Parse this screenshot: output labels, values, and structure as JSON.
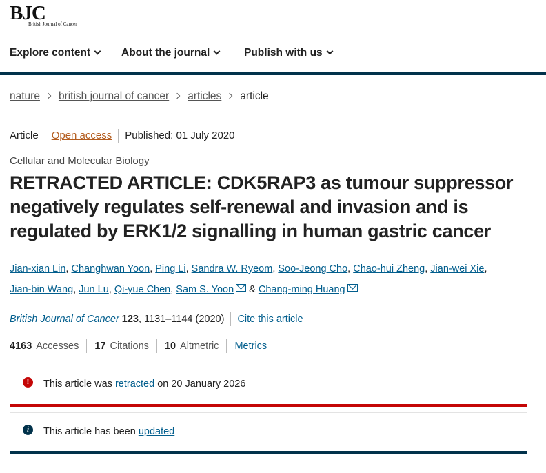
{
  "brand": {
    "logo_main": "BJC",
    "logo_sub": "British Journal of Cancer"
  },
  "nav": {
    "items": [
      "Explore content",
      "About the journal",
      "Publish with us"
    ]
  },
  "breadcrumb": [
    "nature",
    "british journal of cancer",
    "articles",
    "article"
  ],
  "article": {
    "type": "Article",
    "access": "Open access",
    "published": "Published: 01 July 2020",
    "subject": "Cellular and Molecular Biology",
    "title": "RETRACTED ARTICLE: CDK5RAP3 as tumour suppressor negatively regulates self-renewal and invasion and is regulated by ERK1/2 signalling in human gastric cancer"
  },
  "authors": [
    "Jian-xian Lin",
    "Changhwan Yoon",
    "Ping Li",
    "Sandra W. Ryeom",
    "Soo-Jeong Cho",
    "Chao-hui Zheng",
    "Jian-wei Xie",
    "Jian-bin Wang",
    "Jun Lu",
    "Qi-yue Chen",
    "Sam S. Yoon",
    "Chang-ming Huang"
  ],
  "author_separators": {
    "comma": ", ",
    "and": "&"
  },
  "citation": {
    "journal": "British Journal of Cancer",
    "volume": "123",
    "pages_year": ", 1131–1144 (2020)",
    "cite_link": "Cite this article"
  },
  "metrics": {
    "accesses_value": "4163",
    "accesses_label": "Accesses",
    "citations_value": "17",
    "citations_label": "Citations",
    "altmetric_value": "10",
    "altmetric_label": "Altmetric",
    "metrics_link": "Metrics"
  },
  "notices": {
    "retracted": {
      "icon": "!",
      "prefix": "This article was ",
      "link": "retracted",
      "suffix": " on 20 January 2026",
      "color": "#c40606"
    },
    "updated": {
      "icon": "i",
      "prefix": "This article has been ",
      "link": "updated",
      "color": "#01324b"
    }
  },
  "colors": {
    "link": "#025e8d",
    "open_access": "#b35c1e",
    "nav_rule": "#01324b"
  }
}
